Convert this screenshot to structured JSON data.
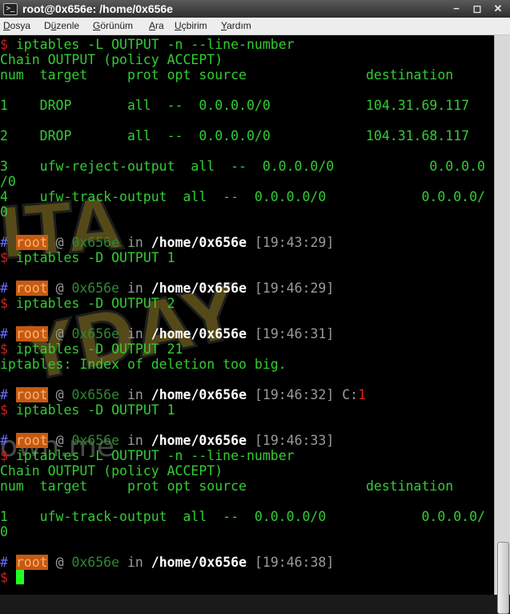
{
  "window": {
    "title": "root@0x656e: /home/0x656e",
    "icon": "terminal-icon",
    "controls": {
      "minimize": "−",
      "maximize": "◻",
      "close": "✕"
    }
  },
  "menu": {
    "items": [
      {
        "label": "Dosya",
        "mnemonic": "D",
        "rest": "osya"
      },
      {
        "label": "Düzenle",
        "mnemonic": "ü",
        "pre": "D",
        "rest": "zenle"
      },
      {
        "label": "Görünüm",
        "mnemonic": "G",
        "rest": "örünüm"
      },
      {
        "label": "Ara",
        "mnemonic": "A",
        "rest": "ra"
      },
      {
        "label": "Uçbirim",
        "mnemonic": "U",
        "rest": "çbirim"
      },
      {
        "label": "Yardım",
        "mnemonic": "Y",
        "rest": "ardım"
      }
    ]
  },
  "prompt": {
    "hash": "#",
    "user": "root",
    "at": "@",
    "host": "0x656e",
    "in": "in",
    "path": "/home/0x656e",
    "dollar": "$"
  },
  "terminal": {
    "l1": "iptables -L OUTPUT -n --line-number",
    "l2": "Chain OUTPUT (policy ACCEPT)",
    "l3": "num  target     prot opt source               destination",
    "l4": "1    DROP       all  --  0.0.0.0/0            104.31.69.117",
    "l5": "2    DROP       all  --  0.0.0.0/0            104.31.68.117",
    "l6": "3    ufw-reject-output  all  --  0.0.0.0/0            0.0.0.0",
    "l7": "/0",
    "l8": "4    ufw-track-output  all  --  0.0.0.0/0            0.0.0.0/",
    "l9": "0",
    "p1_time": "[19:43:29]",
    "c1": "iptables -D OUTPUT 1",
    "p2_time": "[19:46:29]",
    "c2": "iptables -D OUTPUT 2",
    "p3_time": "[19:46:31]",
    "c3": "iptables -D OUTPUT 21",
    "err": "iptables: Index of deletion too big.",
    "p4_time": "[19:46:32]",
    "p4_code_label": "C:",
    "p4_code": "1",
    "c4": "iptables -D OUTPUT 1",
    "p5_time": "[19:46:33]",
    "c5": "iptables -L OUTPUT -n --line-number",
    "o1": "Chain OUTPUT (policy ACCEPT)",
    "o2": "num  target     prot opt source               destination",
    "o3": "1    ufw-track-output  all  --  0.0.0.0/0            0.0.0.0/",
    "o4": "0",
    "p6_time": "[19:46:38]"
  },
  "watermark": {
    "text1": "ITA",
    "text2": "YDAY",
    "text3": "own.me"
  },
  "colors": {
    "green": "#33cc33",
    "orange": "#c55a11",
    "grey": "#9a9a9a",
    "red": "#dd2222",
    "cursor": "#22ff22"
  }
}
